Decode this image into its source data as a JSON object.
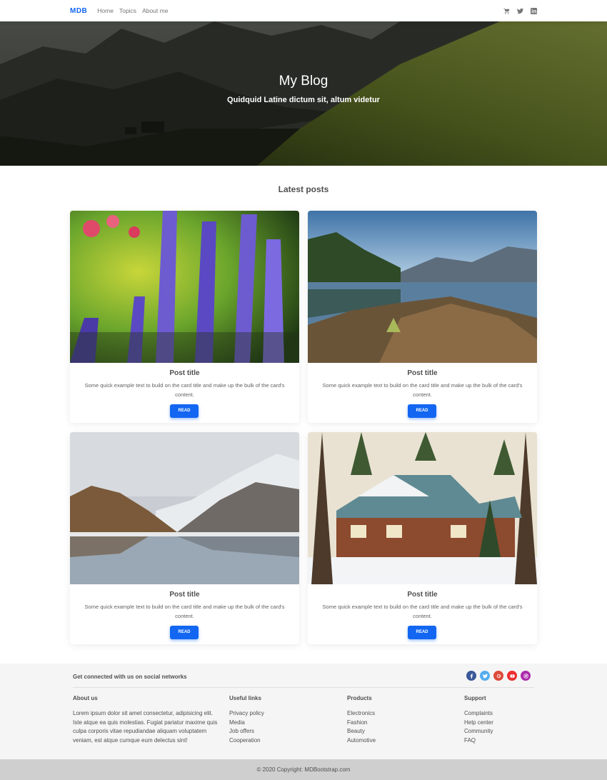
{
  "navbar": {
    "brand": "MDB",
    "links": [
      "Home",
      "Topics",
      "About me"
    ],
    "icons": [
      "cart-icon",
      "twitter-icon",
      "linkedin-icon"
    ]
  },
  "hero": {
    "title": "My Blog",
    "subtitle": "Quidquid Latine dictum sit, altum videtur"
  },
  "main": {
    "section_title": "Latest posts",
    "cards": [
      {
        "title": "Post title",
        "text": "Some quick example text to build on the card title and make up the bulk of the card's content.",
        "button": "READ",
        "image": "lavender-flowers-image"
      },
      {
        "title": "Post title",
        "text": "Some quick example text to build on the card title and make up the bulk of the card's content.",
        "button": "READ",
        "image": "mountain-lake-image"
      },
      {
        "title": "Post title",
        "text": "Some quick example text to build on the card title and make up the bulk of the card's content.",
        "button": "READ",
        "image": "snowy-mountain-lake-image"
      },
      {
        "title": "Post title",
        "text": "Some quick example text to build on the card title and make up the bulk of the card's content.",
        "button": "READ",
        "image": "log-cabin-snow-image"
      }
    ]
  },
  "footer": {
    "social_text": "Get connected with us on social networks",
    "social_icons": [
      "facebook-icon",
      "twitter-icon",
      "google-icon",
      "youtube-icon",
      "instagram-icon"
    ],
    "social_colors": [
      "#3b5998",
      "#55acee",
      "#dd4b39",
      "#ed302f",
      "#ac2bac"
    ],
    "about": {
      "title": "About us",
      "text": "Lorem ipsum dolor sit amet consectetur, adipisicing elit. Iste atque ea quis molestias. Fugiat pariatur maxime quis culpa corporis vitae repudiandae aliquam voluptatem veniam, est atque cumque eum delectus sint!"
    },
    "useful_links": {
      "title": "Useful links",
      "items": [
        "Privacy policy",
        "Media",
        "Job offers",
        "Cooperation"
      ]
    },
    "products": {
      "title": "Products",
      "items": [
        "Electronics",
        "Fashion",
        "Beauty",
        "Automotive"
      ]
    },
    "support": {
      "title": "Support",
      "items": [
        "Complaints",
        "Help center",
        "Community",
        "FAQ"
      ]
    },
    "copyright": {
      "prefix": "© 2020 Copyright:",
      "link": "MDBootstrap.com"
    }
  },
  "colors": {
    "primary": "#1266f1",
    "footer_bg": "#f5f5f5",
    "copyright_bg": "#cfcfcf"
  }
}
